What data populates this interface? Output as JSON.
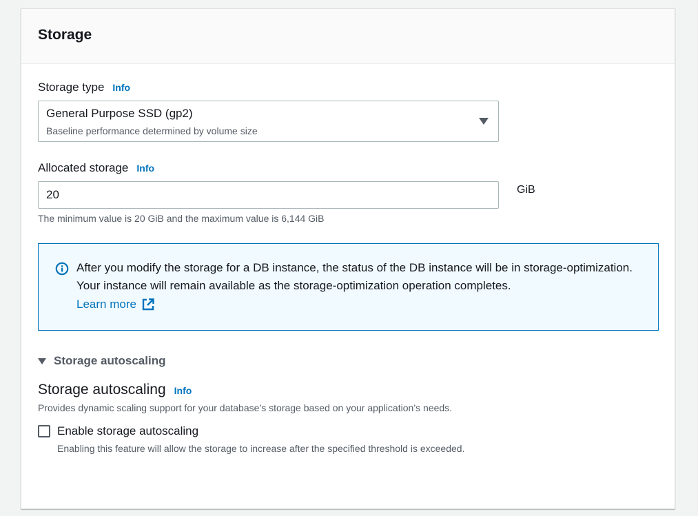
{
  "panel": {
    "title": "Storage"
  },
  "storage_type": {
    "label": "Storage type",
    "info": "Info",
    "selected_value": "General Purpose SSD (gp2)",
    "selected_description": "Baseline performance determined by volume size",
    "icon": "caret-down-icon"
  },
  "allocated_storage": {
    "label": "Allocated storage",
    "info": "Info",
    "value": "20",
    "unit": "GiB",
    "hint": "The minimum value is 20 GiB and the maximum value is 6,144 GiB"
  },
  "alert": {
    "icon": "info-circle-icon",
    "message": "After you modify the storage for a DB instance, the status of the DB instance will be in storage-optimization. Your instance will remain available as the storage-optimization operation completes.",
    "link_label": "Learn more",
    "link_icon": "external-link-icon",
    "colors": {
      "background": "#f1faff",
      "border": "#0073bb"
    }
  },
  "autoscaling": {
    "expander_label": "Storage autoscaling",
    "title": "Storage autoscaling",
    "info": "Info",
    "description": "Provides dynamic scaling support for your database’s storage based on your application’s needs.",
    "checkbox_label": "Enable storage autoscaling",
    "checkbox_checked": false,
    "checkbox_description": "Enabling this feature will allow the storage to increase after the specified threshold is exceeded."
  },
  "colors": {
    "link": "#0073bb",
    "text": "#16191f",
    "secondary_text": "#545b64"
  }
}
